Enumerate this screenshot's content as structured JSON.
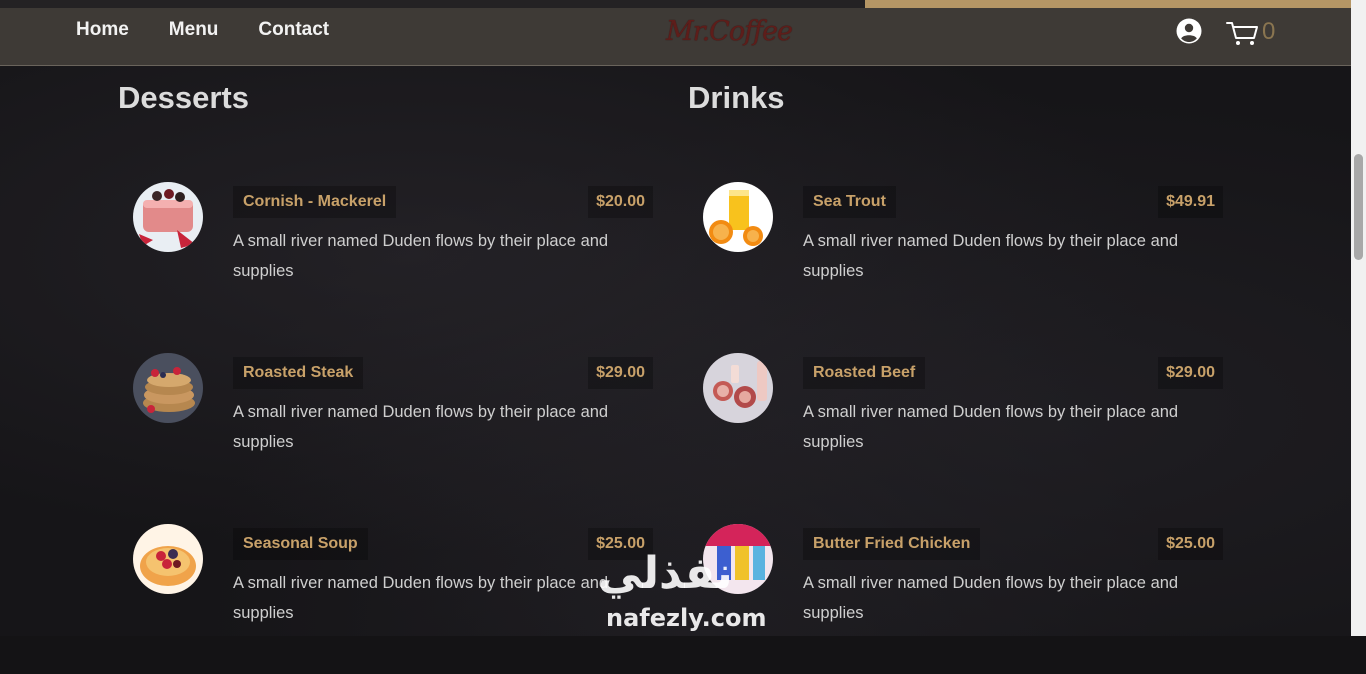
{
  "nav": {
    "links": [
      "Home",
      "Menu",
      "Contact"
    ],
    "logo_text": "Mr.Coffee",
    "cart_count": "0"
  },
  "sections": {
    "desserts_title": "Desserts",
    "drinks_title": "Drinks"
  },
  "desserts": [
    {
      "name": "Cornish - Mackerel",
      "price": "$20.00",
      "description": "A small river named Duden flows by their place and supplies"
    },
    {
      "name": "Roasted Steak",
      "price": "$29.00",
      "description": "A small river named Duden flows by their place and supplies"
    },
    {
      "name": "Seasonal Soup",
      "price": "$25.00",
      "description": "A small river named Duden flows by their place and supplies"
    }
  ],
  "drinks": [
    {
      "name": "Sea Trout",
      "price": "$49.91",
      "description": "A small river named Duden flows by their place and supplies"
    },
    {
      "name": "Roasted Beef",
      "price": "$29.00",
      "description": "A small river named Duden flows by their place and supplies"
    },
    {
      "name": "Butter Fried Chicken",
      "price": "$25.00",
      "description": "A small river named Duden flows by their place and supplies"
    }
  ],
  "watermark": {
    "arabic": "نفذلي",
    "latin": "nafezly.com"
  },
  "colors": {
    "accent": "#c8a169",
    "navbar": "#3e3a36",
    "top_strip": "#b59665"
  }
}
